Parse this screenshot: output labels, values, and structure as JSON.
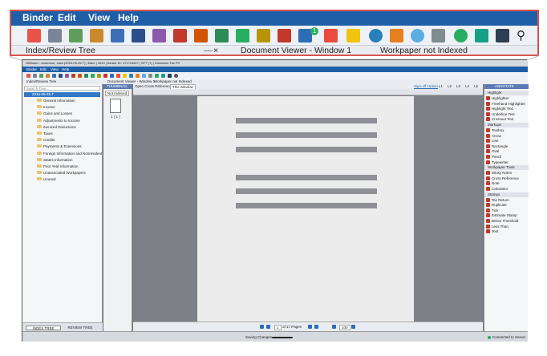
{
  "zoom": {
    "menu": [
      "Binder",
      "Edit",
      "View",
      "Help"
    ],
    "tab_left": "Index/Review Tree",
    "tab_left_badge": "1",
    "tab_right": "Document Viewer - Window 1",
    "status_right": "Workpaper not Indexed",
    "badge_count": "1"
  },
  "window": {
    "title": "GfBinder - Anderson, Jack (2015-09-25 T) | Marc | 2024 | Binder ID: 471710617 | SFT (7) | Gofamom Tax FS",
    "menu": [
      "Binder",
      "Edit",
      "View",
      "Help"
    ],
    "tabs": {
      "index": "Index/Review Tree",
      "viewer": "Document Viewer - Window 1",
      "not_indexed": "Workpaper not Indexed"
    },
    "search_placeholder": "Search Tree...",
    "tree_root": "2015-09-25 T",
    "tree": [
      "General Information",
      "Income",
      "Gains and Losses",
      "Adjustments to Income",
      "Itemized Deductions",
      "Taxes",
      "Credits",
      "Payments & Extensions",
      "Foreign Information and Nonresident",
      "States Information",
      "Prior Year Information",
      "Unassociated Workpapers",
      "Unused"
    ],
    "bottom_tabs": [
      "INDEX TREE",
      "REVIEW TREE"
    ],
    "thumbnail_label": "THUMBNAIL",
    "not_indexed_label": "Not Indexed",
    "thumb_caption": "1 ( 1 )",
    "open_cross_ref": "Open Cross Reference in",
    "this_window": "This Window",
    "signoff": "Sign-off Option",
    "signoff_levels": [
      "L1",
      "L2",
      "L3",
      "L4",
      "L5"
    ],
    "page_info": "of 17 Pages",
    "page_current": "1",
    "zoom_level": "100",
    "status_center": "Saving Changes...",
    "status_right": "Connected to Server",
    "annotate": {
      "title": "ANNOTATE",
      "sections": [
        {
          "name": "Highlight",
          "items": [
            "Highlighter",
            "Freehand Highlighter",
            "Highlight Text",
            "Underline Text",
            "Crossout Text"
          ]
        },
        {
          "name": "Markups",
          "items": [
            "Textbox",
            "Arrow",
            "Line",
            "Rectangle",
            "Oval",
            "Pencil",
            "Typewriter"
          ]
        },
        {
          "name": "Workpaper Tools",
          "items": [
            "Sticky Notes",
            "Cross Reference",
            "Note",
            "Calculator"
          ]
        },
        {
          "name": "Stamps",
          "items": [
            "Tax Return",
            "Duplicate",
            "Tick",
            "Estimate Stamp",
            "Below Threshold",
            "Less Than",
            "Test"
          ]
        }
      ]
    }
  },
  "colors": {
    "menubar": "#1f5fa8",
    "callout_border": "#d9534f",
    "accent": "#2d6db5"
  }
}
